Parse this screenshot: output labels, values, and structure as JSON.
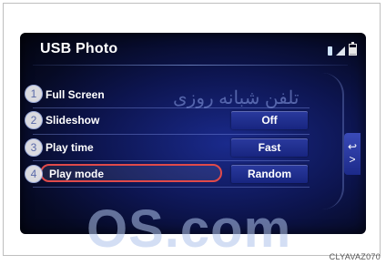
{
  "screen": {
    "title": "USB Photo",
    "status_icons": [
      "bluetooth-icon",
      "signal-icon",
      "battery-icon"
    ]
  },
  "menu": [
    {
      "index": "1",
      "label": "Full Screen",
      "value": ""
    },
    {
      "index": "2",
      "label": "Slideshow",
      "value": "Off"
    },
    {
      "index": "3",
      "label": "Play time",
      "value": "Fast"
    },
    {
      "index": "4",
      "label": "Play mode",
      "value": "Random",
      "highlighted": true
    }
  ],
  "back_button": {
    "glyph": "↩ >"
  },
  "watermark": {
    "persian_text": "تلفن شبانه روزی",
    "big_text": "OS.com"
  },
  "caption": "CLYAVAZ070",
  "colors": {
    "highlight": "#e04a4a",
    "screen_bg": "#0d1550",
    "value_box": "#1f2f90"
  }
}
